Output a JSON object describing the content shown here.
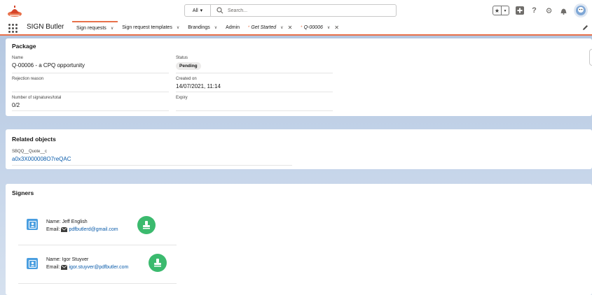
{
  "header": {
    "search_scope": "All",
    "search_placeholder": "Search..."
  },
  "nav": {
    "app_name": "SIGN Butler",
    "items": [
      {
        "label": "Sign requests"
      },
      {
        "label": "Sign request templates"
      },
      {
        "label": "Brandings"
      },
      {
        "label": "Admin"
      },
      {
        "label": "Get Started"
      },
      {
        "label": "Q-00006"
      }
    ]
  },
  "package": {
    "title": "Package",
    "name_label": "Name",
    "name_value": "Q-00006 - a CPQ opportunity",
    "status_label": "Status",
    "status_value": "Pending",
    "rejection_label": "Rejection reason",
    "rejection_value": "",
    "created_label": "Created on",
    "created_value": "14/07/2021, 11:14",
    "signatures_label": "Number of signatures/total",
    "signatures_value": "0/2",
    "expiry_label": "Expiry",
    "expiry_value": ""
  },
  "related": {
    "title": "Related objects",
    "field_label": "SBQQ__Quote__c",
    "field_value": "a0x3X000008O7reQAC"
  },
  "signers": {
    "title": "Signers",
    "name_prefix": "Name:",
    "email_prefix": "Email:",
    "items": [
      {
        "name": "Jeff English",
        "email": "pdfbutlerd@gmail.com"
      },
      {
        "name": "Igor Stuyver",
        "email": "igor.stuyver@pdfbutler.com"
      }
    ]
  },
  "colors": {
    "brand_accent": "#e8704a",
    "link": "#0b5cab",
    "contact_icon": "#4a9ee0",
    "stamp_icon": "#3bba6e"
  }
}
